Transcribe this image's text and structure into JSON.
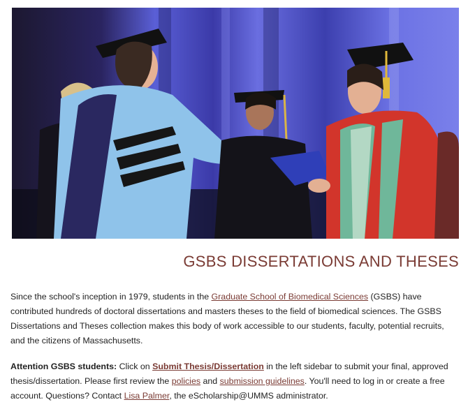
{
  "hero": {
    "image": "graduation-hooding-ceremony-photo",
    "colors": {
      "backdrop": "#4a4fc4",
      "dark": "#0e0d18",
      "light_blue_robe": "#8fc3ea",
      "red_robe": "#d2352b",
      "green_trim": "#6fb79a"
    }
  },
  "page": {
    "title": "GSBS DISSERTATIONS AND THESES",
    "accent_color": "#7a3b34"
  },
  "intro": {
    "text_before_link": "Since the school's inception in 1979, students in the ",
    "gsbs_link": "Graduate School of Biomedical Sciences",
    "text_after_link": " (GSBS) have contributed hundreds of doctoral dissertations and masters theses to the field of biomedical sciences. The GSBS Dissertations and Theses collection makes this body of work accessible to our students, faculty, potential recruits, and the citizens of Massachusetts."
  },
  "attention": {
    "label": "Attention GSBS students:",
    "text_click_on": " Click on ",
    "submit_link": "Submit Thesis/Dissertation",
    "text_after_submit": " in the left sidebar to submit your final, approved thesis/dissertation. Please first review the ",
    "policies_link": "policies",
    "text_and": " and ",
    "guidelines_link": "submission guidelines",
    "text_after_guidelines": ". You'll need to log in or create a free account. Questions? Contact ",
    "contact_link": "Lisa Palmer",
    "text_end": ", the eScholarship@UMMS administrator."
  }
}
